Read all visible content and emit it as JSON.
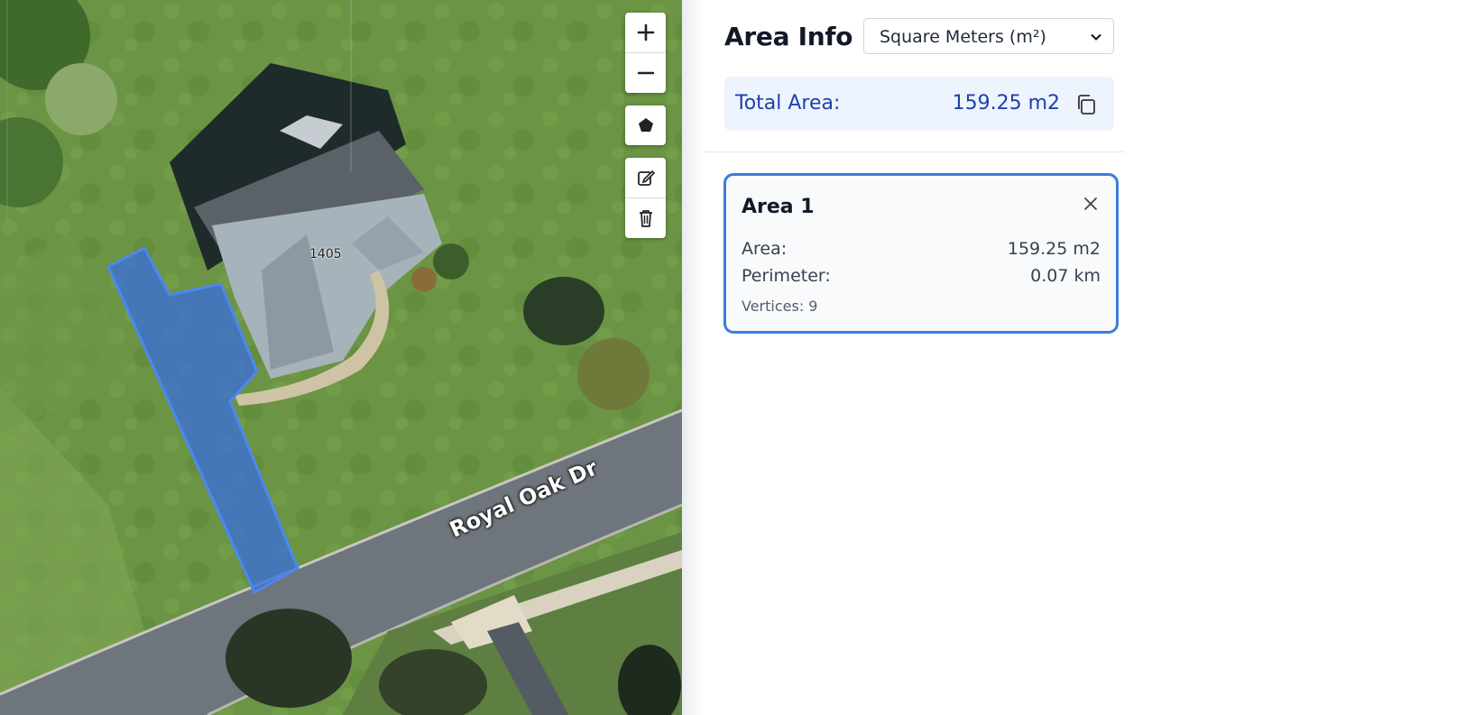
{
  "map": {
    "street_label": "Royal Oak Dr",
    "house_number": "1405",
    "tools": {
      "zoom_in_icon": "plus-icon",
      "zoom_out_icon": "minus-icon",
      "draw_polygon_icon": "pentagon-icon",
      "edit_icon": "edit-icon",
      "delete_icon": "trash-icon"
    },
    "polygon_color": "#3b6fd8"
  },
  "panel": {
    "title": "Area Info",
    "unit_select": {
      "selected": "Square Meters (m²)"
    },
    "total": {
      "label": "Total Area:",
      "value": "159.25 m2"
    },
    "areas": [
      {
        "name": "Area 1",
        "area_label": "Area:",
        "area_value": "159.25 m2",
        "perimeter_label": "Perimeter:",
        "perimeter_value": "0.07 km",
        "vertices_text": "Vertices: 9"
      }
    ]
  },
  "colors": {
    "accent": "#3b7ddd",
    "total_text": "#1e40af",
    "total_bg": "#eef4fd"
  }
}
